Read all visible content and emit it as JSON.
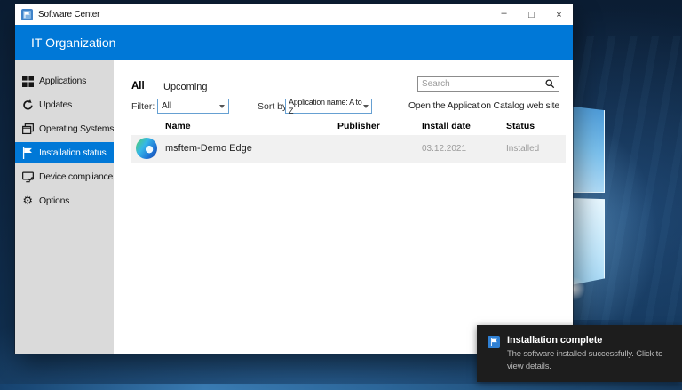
{
  "colors": {
    "accent": "#0078d7",
    "sidebar_bg": "#dadada",
    "row_bg": "#f1f1f1",
    "toast_bg": "#1d1d1d"
  },
  "window": {
    "title": "Software Center",
    "controls": {
      "minimize": "–",
      "maximize": "□",
      "close": "×"
    },
    "banner": "IT Organization"
  },
  "sidebar": {
    "items": [
      {
        "label": "Applications",
        "icon": "apps-grid-icon",
        "selected": false
      },
      {
        "label": "Updates",
        "icon": "refresh-icon",
        "selected": false
      },
      {
        "label": "Operating Systems",
        "icon": "windows-stack-icon",
        "selected": false
      },
      {
        "label": "Installation status",
        "icon": "flag-icon",
        "selected": true
      },
      {
        "label": "Device compliance",
        "icon": "monitor-check-icon",
        "selected": false
      },
      {
        "label": "Options",
        "icon": "gear-icon",
        "selected": false
      }
    ]
  },
  "main": {
    "tabs": [
      {
        "label": "All",
        "selected": true
      },
      {
        "label": "Upcoming",
        "selected": false
      }
    ],
    "filter_label": "Filter:",
    "filter_value": "All",
    "sort_label": "Sort by:",
    "sort_value": "Application name: A to Z",
    "search_placeholder": "Search",
    "catalog_link": "Open the Application Catalog web site",
    "table": {
      "columns": [
        "Name",
        "Publisher",
        "Install date",
        "Status"
      ],
      "rows": [
        {
          "name": "msftem-Demo Edge",
          "publisher": "",
          "install_date": "03.12.2021",
          "status": "Installed",
          "icon": "edge-logo-icon"
        }
      ]
    }
  },
  "toast": {
    "title": "Installation complete",
    "message": "The software installed successfully. Click to view details."
  }
}
